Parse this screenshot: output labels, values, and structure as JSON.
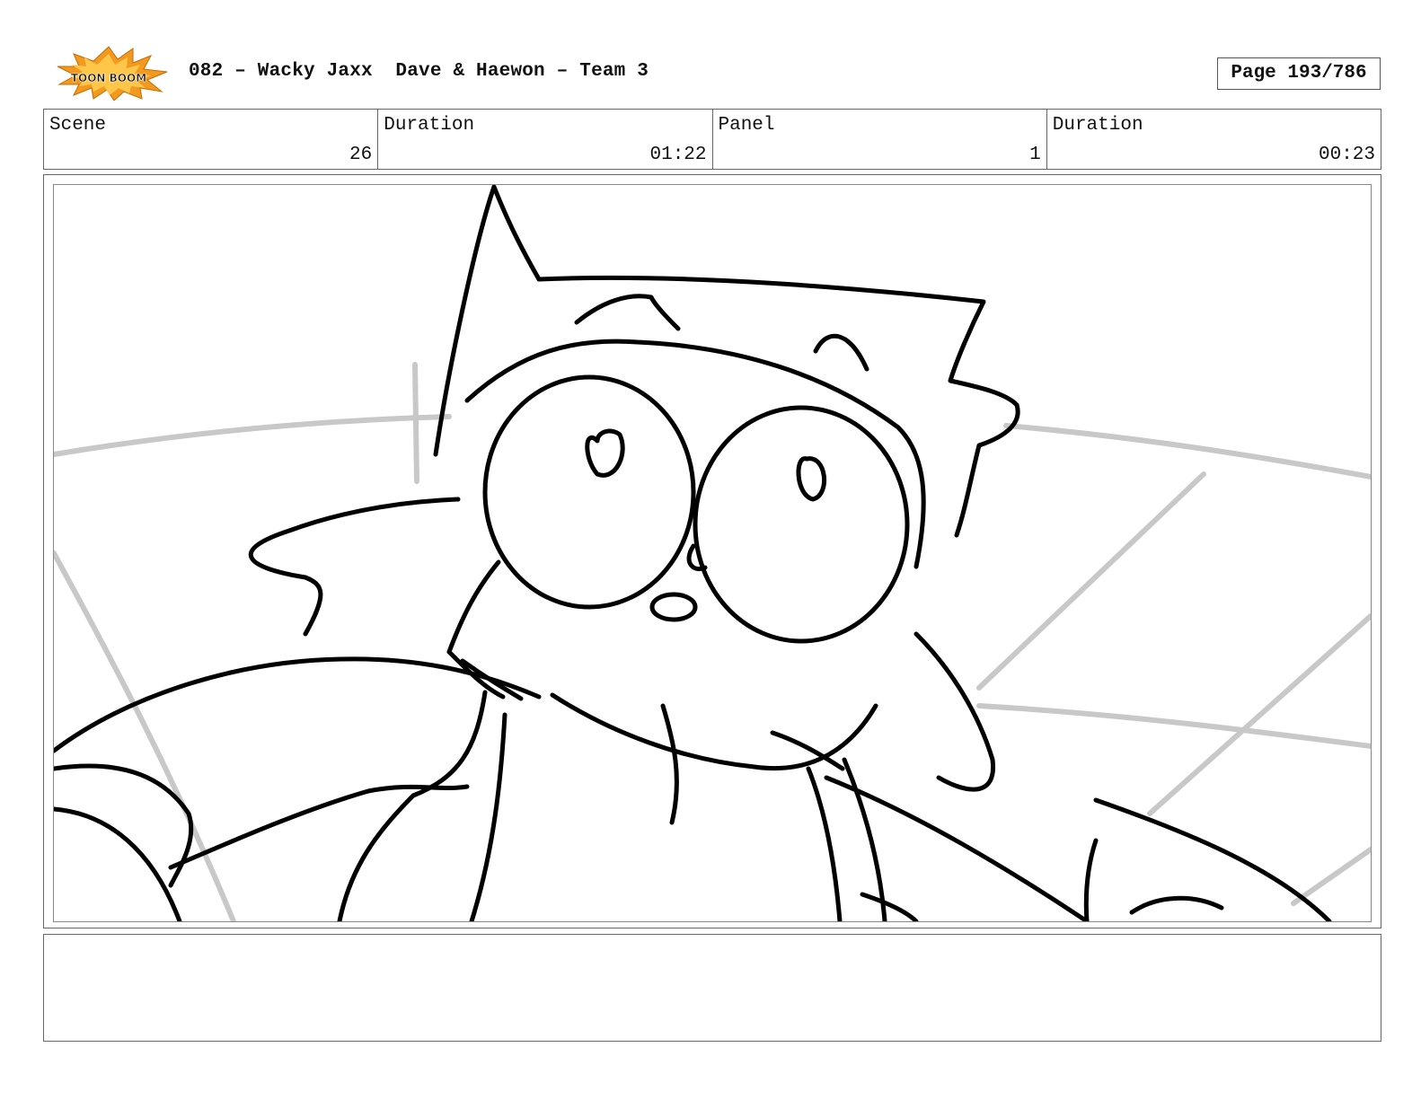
{
  "header": {
    "logo_text": "TOON BOOM",
    "title": "082 – Wacky Jaxx  Dave & Haewon – Team 3",
    "page": "Page 193/786"
  },
  "info": {
    "scene_label": "Scene",
    "scene_value": "26",
    "scene_duration_label": "Duration",
    "scene_duration_value": "01:22",
    "panel_label": "Panel",
    "panel_value": "1",
    "panel_duration_label": "Duration",
    "panel_duration_value": "00:23"
  },
  "notes": {
    "text": ""
  },
  "colors": {
    "logo_orange": "#f29a1f",
    "logo_black": "#111111",
    "border": "#666666",
    "sketch_line": "#000000",
    "background_line": "#c8c8c8"
  }
}
